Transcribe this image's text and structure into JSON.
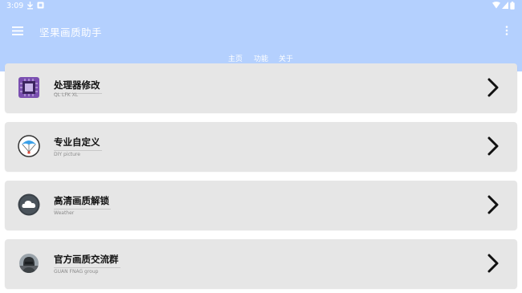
{
  "status_bar": {
    "time": "3:09"
  },
  "app_bar": {
    "title": "坚果画质助手"
  },
  "tabs": [
    {
      "label": "主页",
      "selected": true
    },
    {
      "label": "功能",
      "selected": false
    },
    {
      "label": "关于",
      "selected": false
    }
  ],
  "cards": [
    {
      "title": "处理器修改",
      "subtitle": "QL LFK XL",
      "icon": "cpu-icon"
    },
    {
      "title": "专业自定义",
      "subtitle": "DIY picture",
      "icon": "parachute-icon"
    },
    {
      "title": "高清画质解锁",
      "subtitle": "Weather",
      "icon": "cloud-icon"
    },
    {
      "title": "官方画质交流群",
      "subtitle": "GUAN FNAG group",
      "icon": "avatar-icon"
    }
  ],
  "colors": {
    "app_bar": "#b4d0fe",
    "card_background": "#e6e6e6",
    "on_primary": "#ffffff"
  }
}
